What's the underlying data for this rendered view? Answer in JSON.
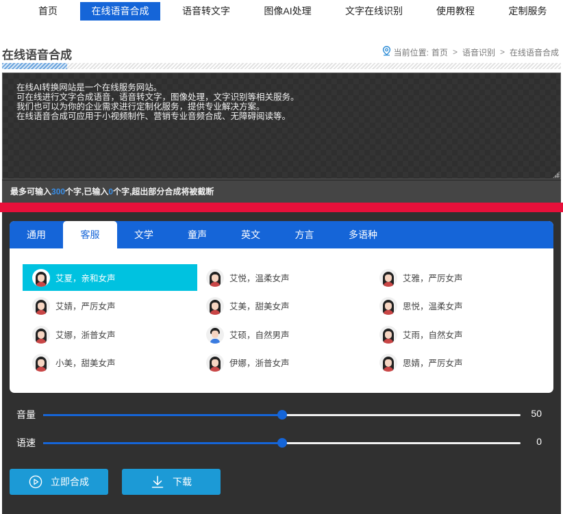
{
  "nav": {
    "items": [
      {
        "label": "首页"
      },
      {
        "label": "在线语音合成",
        "active": true
      },
      {
        "label": "语音转文字"
      },
      {
        "label": "图像AI处理"
      },
      {
        "label": "文字在线识别"
      },
      {
        "label": "使用教程"
      },
      {
        "label": "定制服务"
      }
    ]
  },
  "page": {
    "title": "在线语音合成",
    "breadcrumb": {
      "prefix": "当前位置:",
      "items": [
        "首页",
        "语音识别",
        "在线语音合成"
      ]
    }
  },
  "editor": {
    "text": "在线AI转换网站是一个在线服务网站。\n可在线进行文字合成语音，语音转文字，图像处理，文字识别等相关服务。\n我们也可以为你的企业需求进行定制化服务，提供专业解决方案。\n在线语音合成可应用于小视频制作、营销专业音频合成、无障碍阅读等。"
  },
  "counter": {
    "prefix": "最多可输入",
    "max": "300",
    "mid": "个字,已输入",
    "current": "0",
    "suffix": "个字,超出部分合成将被截断"
  },
  "voice_tabs": [
    {
      "label": "通用"
    },
    {
      "label": "客服",
      "active": true
    },
    {
      "label": "文学"
    },
    {
      "label": "童声"
    },
    {
      "label": "英文"
    },
    {
      "label": "方言"
    },
    {
      "label": "多语种"
    }
  ],
  "voices": [
    {
      "label": "艾夏，亲和女声",
      "selected": true,
      "avatar": "female-avatar-icon"
    },
    {
      "label": "艾悦，温柔女声",
      "avatar": "female-avatar-icon"
    },
    {
      "label": "艾雅，严厉女声",
      "avatar": "female-avatar-icon"
    },
    {
      "label": "艾婧，严厉女声",
      "avatar": "female-avatar-icon"
    },
    {
      "label": "艾美，甜美女声",
      "avatar": "female-avatar-icon"
    },
    {
      "label": "思悦，温柔女声",
      "avatar": "female-avatar-icon"
    },
    {
      "label": "艾娜，浙普女声",
      "avatar": "female-avatar-icon"
    },
    {
      "label": "艾硕，自然男声",
      "avatar": "male-avatar-icon"
    },
    {
      "label": "艾雨，自然女声",
      "avatar": "female-avatar-icon"
    },
    {
      "label": "小美，甜美女声",
      "avatar": "female-avatar-icon"
    },
    {
      "label": "伊娜，浙普女声",
      "avatar": "female-avatar-icon"
    },
    {
      "label": "思婧，严厉女声",
      "avatar": "female-avatar-icon"
    }
  ],
  "sliders": {
    "volume": {
      "label": "音量",
      "value": "50",
      "fraction": 0.5
    },
    "speed": {
      "label": "语速",
      "value": "0",
      "fraction": 0.5
    }
  },
  "buttons": {
    "synthesize": {
      "label": "立即合成",
      "icon": "play-circle-icon"
    },
    "download": {
      "label": "下载",
      "icon": "download-icon"
    }
  },
  "colors": {
    "primary": "#1565d8",
    "selected": "#00c2e0",
    "accent_red": "#e8103a",
    "button": "#1c9ad6",
    "panel": "#303030"
  }
}
